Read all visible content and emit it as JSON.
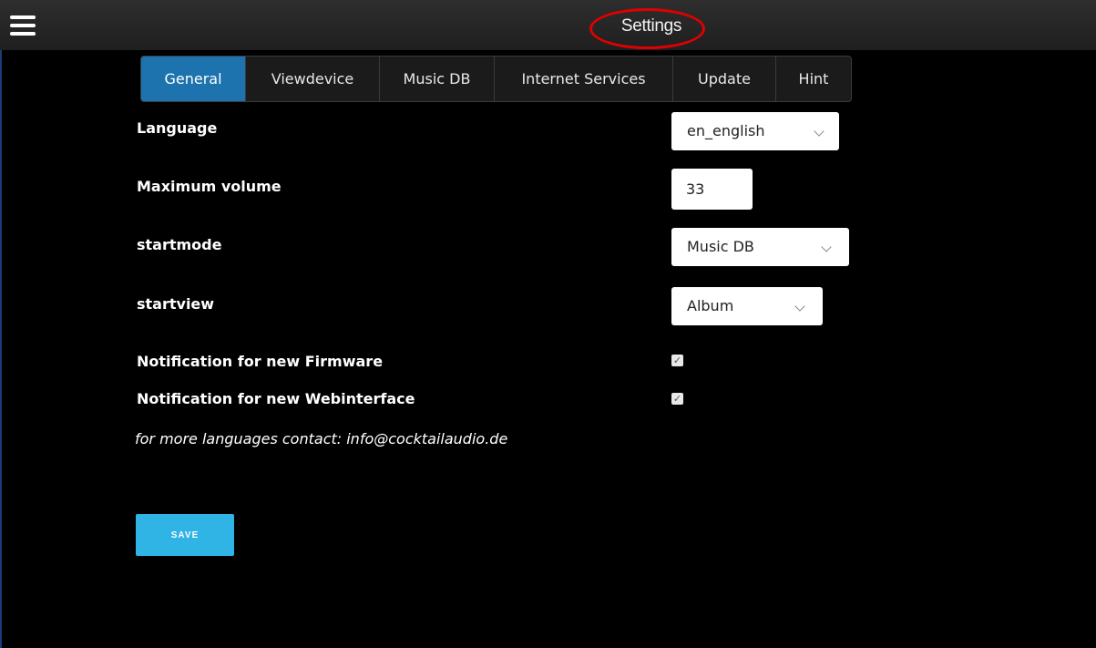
{
  "header": {
    "title": "Settings",
    "menu_icon": "hamburger-menu-icon"
  },
  "tabs": [
    {
      "label": "General",
      "active": true
    },
    {
      "label": "Viewdevice",
      "active": false
    },
    {
      "label": "Music DB",
      "active": false
    },
    {
      "label": "Internet Services",
      "active": false
    },
    {
      "label": "Update",
      "active": false
    },
    {
      "label": "Hint",
      "active": false
    }
  ],
  "settings": {
    "language": {
      "label": "Language",
      "value": "en_english"
    },
    "max_volume": {
      "label": "Maximum volume",
      "value": "33"
    },
    "startmode": {
      "label": "startmode",
      "value": "Music DB"
    },
    "startview": {
      "label": "startview",
      "value": "Album"
    },
    "notify_firmware": {
      "label": "Notification for new Firmware",
      "checked": true
    },
    "notify_webinterface": {
      "label": "Notification for new Webinterface",
      "checked": true
    }
  },
  "note": "for more languages contact: info@cocktailaudio.de",
  "save_label": "SAVE",
  "colors": {
    "accent_tab": "#1d73ad",
    "save_button": "#2fb4e5",
    "annotation": "#e00000"
  }
}
